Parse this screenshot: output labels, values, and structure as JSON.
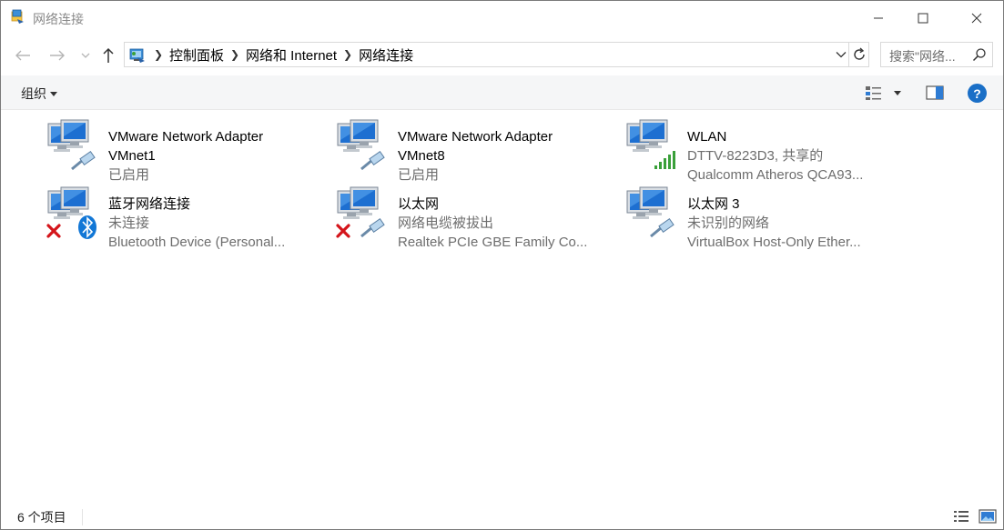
{
  "window": {
    "title": "网络连接",
    "controls": {
      "minimize_icon": "minimize-icon",
      "maximize_icon": "maximize-icon",
      "close_icon": "close-icon"
    }
  },
  "navigation": {
    "breadcrumbs": [
      "控制面板",
      "网络和 Internet",
      "网络连接"
    ],
    "search_placeholder": "搜索\"网络..."
  },
  "toolbar": {
    "organize_label": "组织",
    "help_label": "?"
  },
  "connections": [
    {
      "name": "VMware Network Adapter",
      "name2": "VMnet1",
      "status": "已启用",
      "device": "",
      "icon": "ethernet-enabled",
      "overlay": "none"
    },
    {
      "name": "VMware Network Adapter",
      "name2": "VMnet8",
      "status": "已启用",
      "device": "",
      "icon": "ethernet-enabled",
      "overlay": "none"
    },
    {
      "name": "WLAN",
      "name2": "",
      "status": "DTTV-8223D3, 共享的",
      "device": "Qualcomm Atheros QCA93...",
      "icon": "wifi",
      "overlay": "signal"
    },
    {
      "name": "蓝牙网络连接",
      "name2": "",
      "status": "未连接",
      "device": "Bluetooth Device (Personal...",
      "icon": "bluetooth",
      "overlay": "disconnected"
    },
    {
      "name": "以太网",
      "name2": "",
      "status": "网络电缆被拔出",
      "device": "Realtek PCIe GBE Family Co...",
      "icon": "ethernet-unplugged",
      "overlay": "disconnected"
    },
    {
      "name": "以太网 3",
      "name2": "",
      "status": "未识别的网络",
      "device": "VirtualBox Host-Only Ether...",
      "icon": "ethernet-enabled",
      "overlay": "none"
    }
  ],
  "status_bar": {
    "item_count": "6 个项目"
  },
  "colors": {
    "accent": "#1a6fc7",
    "disconnect_red": "#d4151b",
    "signal_green": "#3aa03a",
    "bluetooth_blue": "#1277d6"
  }
}
